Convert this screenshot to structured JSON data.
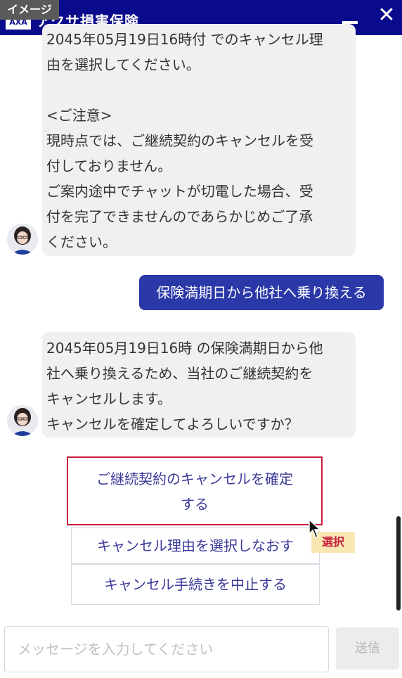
{
  "badge": "イメージ",
  "header": {
    "logo_text": "AXA",
    "title": "アクサ損害保険",
    "close_glyph": "✕"
  },
  "bot_message_1": {
    "lines": [
      "2045年05月19日16時付 でのキャンセル理",
      "由を選択してください。",
      "",
      "<ご注意>",
      "現時点では、ご継続契約のキャンセルを受",
      "付しておりません。",
      "ご案内途中でチャットが切電した場合、受",
      "付を完了できませんのであらかじめご了承",
      "ください。"
    ]
  },
  "user_message": "保険満期日から他社へ乗り換える",
  "bot_message_2": {
    "lines": [
      "2045年05月19日16時 の保険満期日から他",
      "社へ乗り換えるため、当社のご継続契約を",
      "キャンセルします。",
      "キャンセルを確定してよろしいですか？"
    ]
  },
  "options": {
    "confirm_line1": "ご継続契約のキャンセルを確定",
    "confirm_line2": "する",
    "reselect": "キャンセル理由を選択しなおす",
    "abort": "キャンセル手続きを中止する"
  },
  "select_badge": "選択",
  "input": {
    "placeholder": "メッセージを入力してください"
  },
  "send_label": "送信"
}
